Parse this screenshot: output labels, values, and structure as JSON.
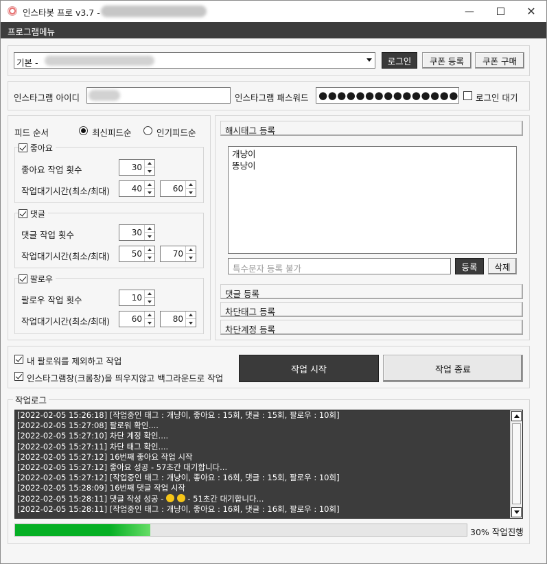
{
  "window": {
    "title": "인스타봇 프로 v3.7 -",
    "icon": "app-logo-icon"
  },
  "menubar": {
    "items": [
      "프로그램메뉴"
    ]
  },
  "account": {
    "selected": "기본 -",
    "login_label": "로그인",
    "coupon_register_label": "쿠폰 등록",
    "coupon_buy_label": "쿠폰 구매"
  },
  "credentials": {
    "id_label": "인스타그램 아이디",
    "pw_label": "인스타그램 패스워드",
    "pw_value": "●●●●●●●●●●●●●●●",
    "login_wait_label": "로그인 대기",
    "login_wait_checked": false
  },
  "feed": {
    "order_label": "피드 순서",
    "latest_label": "최신피드순",
    "popular_label": "인기피드순",
    "selected": "latest"
  },
  "like": {
    "title": "좋아요",
    "enabled": true,
    "count_label": "좋아요 작업 횟수",
    "count": "30",
    "wait_label": "작업대기시간(최소/최대)",
    "wait_min": "40",
    "wait_max": "60"
  },
  "comment": {
    "title": "댓글",
    "enabled": true,
    "count_label": "댓글 작업 횟수",
    "count": "30",
    "wait_label": "작업대기시간(최소/최대)",
    "wait_min": "50",
    "wait_max": "70"
  },
  "follow": {
    "title": "팔로우",
    "enabled": true,
    "count_label": "팔로우 작업 횟수",
    "count": "10",
    "wait_label": "작업대기시간(최소/최대)",
    "wait_min": "60",
    "wait_max": "80"
  },
  "hashtag": {
    "header": "해시태그 등록",
    "tags": [
      "개냥이",
      "똥냥이"
    ],
    "input_placeholder": "특수문자 등록 불가",
    "add_label": "등록",
    "delete_label": "삭제"
  },
  "sections": {
    "comment_register": "댓글 등록",
    "block_tag_register": "차단태그 등록",
    "block_account_register": "차단계정 등록"
  },
  "options": {
    "exclude_followers_label": "내 팔로워를 제외하고 작업",
    "exclude_followers_checked": true,
    "background_label": "인스타그램창(크롬창)을 띄우지않고 백그라운드로 작업",
    "background_checked": true,
    "start_label": "작업 시작",
    "stop_label": "작업 종료"
  },
  "log": {
    "title": "작업로그",
    "lines": [
      "[2022-02-05 15:26:18] [작업중인 태그 : 개냥이, 좋아요 : 15회, 댓글 : 15회, 팔로우 : 10회]",
      "[2022-02-05 15:27:08] 팔로워 확인....",
      "[2022-02-05 15:27:10] 차단 계정 확인....",
      "[2022-02-05 15:27:11] 차단 태그 확인....",
      "[2022-02-05 15:27:12] 16번째 좋아요 작업 시작",
      "[2022-02-05 15:27:12] 좋아요 성공 - 57초간 대기합니다...",
      "[2022-02-05 15:27:12] [작업중인 태그 : 개냥이, 좋아요 : 16회, 댓글 : 15회, 팔로우 : 10회]",
      "[2022-02-05 15:28:09] 16번째 댓글 작업 시작"
    ],
    "emoji_line_prefix": "[2022-02-05 15:28:11] 댓글 작성 성공 - ",
    "emoji_line_suffix": " - 51초간 대기합니다...",
    "emoji_icon": "heart-eyes-emoji-icon",
    "last_line": "[2022-02-05 15:28:11] [작업중인 태그 : 개냥이, 좋아요 : 16회, 댓글 : 16회, 팔로우 : 10회]"
  },
  "progress": {
    "percent": 30,
    "label": "30% 작업진행",
    "color": "#06b025"
  }
}
